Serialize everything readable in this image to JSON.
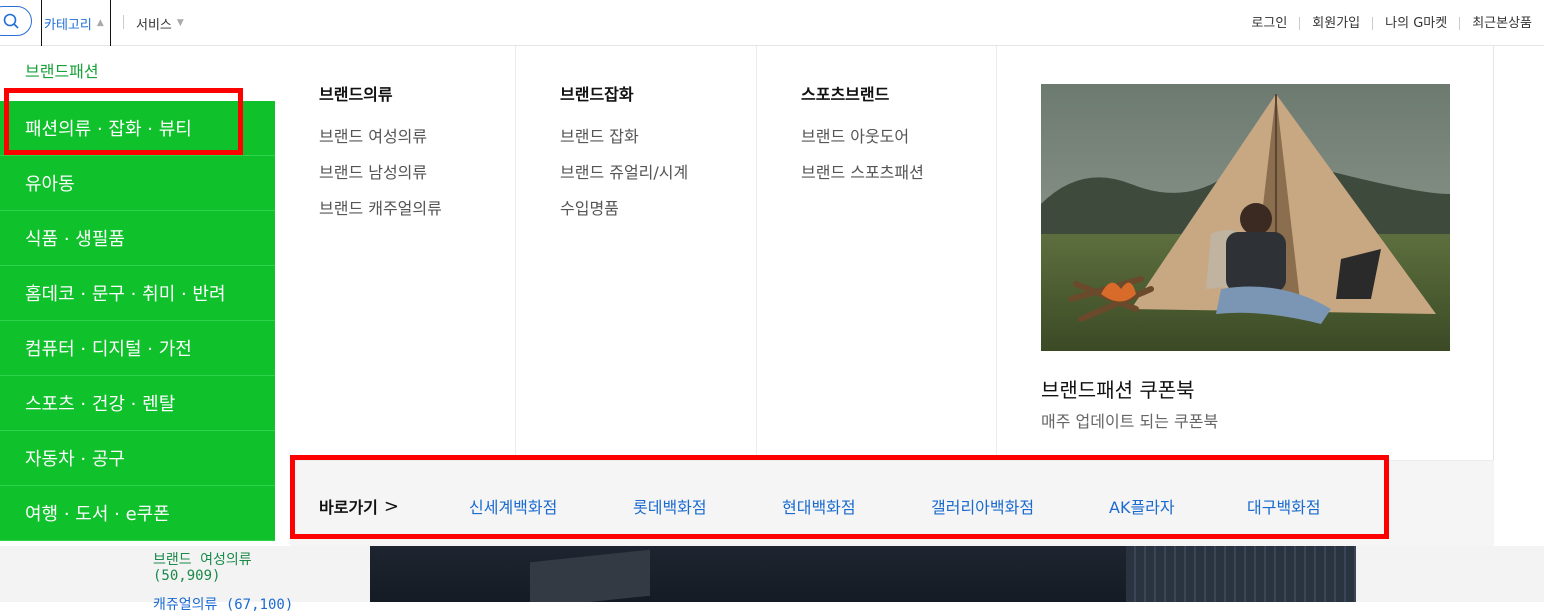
{
  "topbar": {
    "category_label": "카테고리",
    "service_label": "서비스",
    "user_links": [
      "로그인",
      "회원가입",
      "나의 G마켓",
      "최근본상품"
    ]
  },
  "dropdown": {
    "side_title": "브랜드패션",
    "side_items": [
      "패션의류 · 잡화 · 뷰티",
      "유아동",
      "식품 · 생필품",
      "홈데코 · 문구 · 취미 · 반려",
      "컴퓨터 · 디지털 · 가전",
      "스포츠 · 건강 · 렌탈",
      "자동차 · 공구",
      "여행 · 도서 · e쿠폰"
    ],
    "columns": [
      {
        "title": "브랜드의류",
        "items": [
          "브랜드 여성의류",
          "브랜드 남성의류",
          "브랜드 캐주얼의류"
        ]
      },
      {
        "title": "브랜드잡화",
        "items": [
          "브랜드 잡화",
          "브랜드 쥬얼리/시계",
          "수입명품"
        ]
      },
      {
        "title": "스포츠브랜드",
        "items": [
          "브랜드 아웃도어",
          "브랜드 스포츠패션"
        ]
      }
    ],
    "promo": {
      "title": "브랜드패션 쿠폰북",
      "subtitle": "매주 업데이트 되는 쿠폰북"
    },
    "shortcut": {
      "label": "바로가기",
      "links": [
        "신세계백화점",
        "롯데백화점",
        "현대백화점",
        "갤러리아백화점",
        "AK플라자",
        "대구백화점"
      ]
    }
  },
  "background": {
    "link1": "브랜드 여성의류",
    "count1": "(50,909)",
    "link2": "캐쥬얼의류 (67,100)"
  },
  "colors": {
    "accent_green": "#0fc12b",
    "link_blue": "#1a6ad0",
    "highlight_red": "#ff0000"
  }
}
